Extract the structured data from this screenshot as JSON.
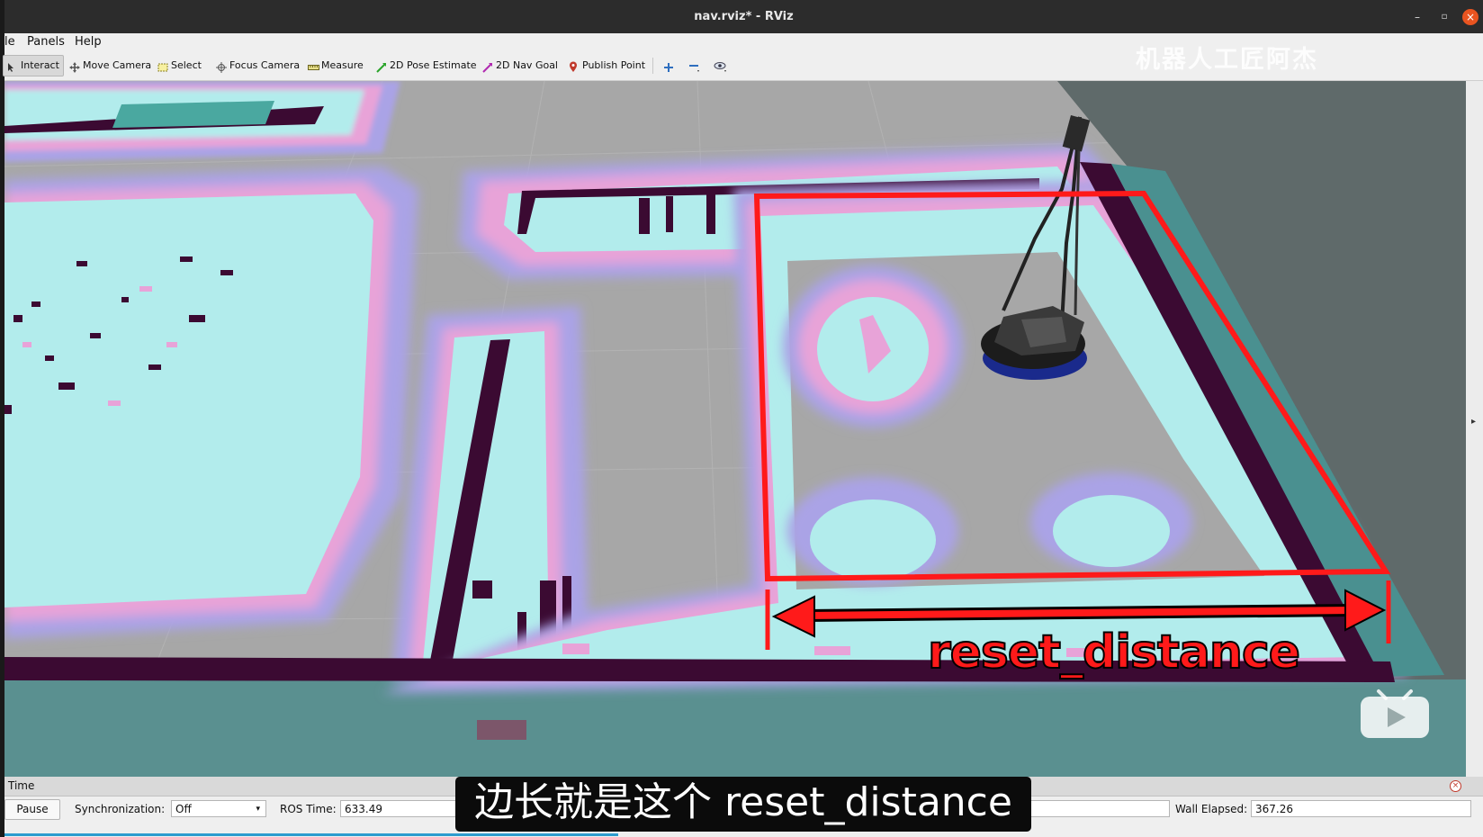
{
  "window": {
    "title": "nav.rviz* - RViz",
    "minimize": "–",
    "maximize": "▫",
    "close": "×"
  },
  "menu": {
    "file": "le",
    "panels": "Panels",
    "help": "Help"
  },
  "toolbar": {
    "interact": "Interact",
    "move_camera": "Move Camera",
    "select": "Select",
    "focus_camera": "Focus Camera",
    "measure": "Measure",
    "pose_estimate": "2D Pose Estimate",
    "nav_goal": "2D Nav Goal",
    "publish_point": "Publish Point",
    "active_tool": "Interact"
  },
  "watermark": "机器人工匠阿杰",
  "annotation": {
    "label": "reset_distance",
    "color": "#ff1a1a"
  },
  "time_panel": {
    "title": "Time",
    "pause_label": "Pause",
    "sync_label": "Synchronization:",
    "sync_value": "Off",
    "ros_time_label": "ROS Time:",
    "ros_time_value": "633.49",
    "wall_elapsed_label": "Wall Elapsed:",
    "wall_elapsed_value": "367.26"
  },
  "subtitle": "边长就是这个 reset_distance",
  "colors": {
    "free_space": "#a7a7a7",
    "inflation_outer": "#aaa3e6",
    "inflation_mid": "#e8a3d8",
    "inscribed": "#b2ecec",
    "lethal": "#3b0a32",
    "unknown": "#5a9090",
    "robot_base": "#1a2a8c"
  }
}
